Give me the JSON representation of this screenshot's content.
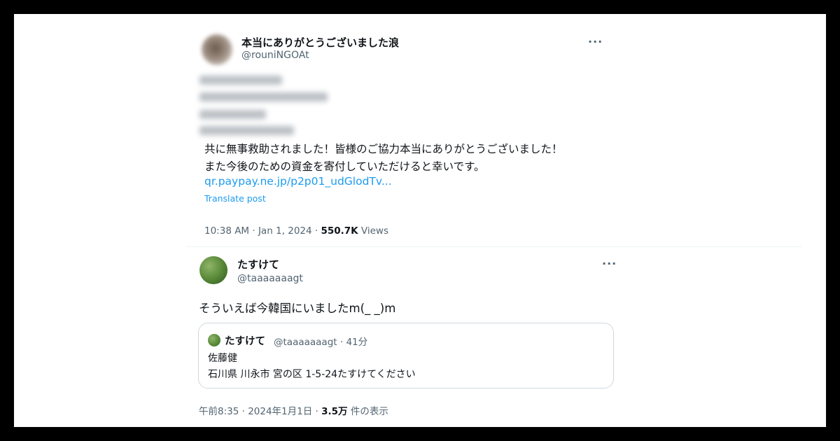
{
  "tweet1": {
    "display_name": "本当にありがとうございました浪",
    "handle": "@rouniNGOAt",
    "more": "···",
    "text_line1": "共に無事救助されました！皆様のご協力本当にありがとうございました！",
    "text_line2": "また今後のための資金を寄付していただけると幸いです。",
    "link": "qr.paypay.ne.jp/p2p01_udGlodTv...",
    "translate": "Translate post",
    "timestamp": "10:38 AM · Jan 1, 2024 · ",
    "views_count": "550.7K",
    "views_label": " Views"
  },
  "tweet2": {
    "display_name": "たすけて",
    "handle": "@taaaaaaagt",
    "more": "···",
    "text": "そういえば今韓国にいましたm(_ _)m",
    "quote": {
      "display_name": "たすけて",
      "handle_time": "@taaaaaaagt · 41分",
      "line1": "佐藤健",
      "line2": "石川県 川永市 宮の区 1-5-24たすけてください"
    },
    "timestamp": "午前8:35 · 2024年1月1日 · ",
    "views_count": "3.5万",
    "views_label": " 件の表示"
  }
}
